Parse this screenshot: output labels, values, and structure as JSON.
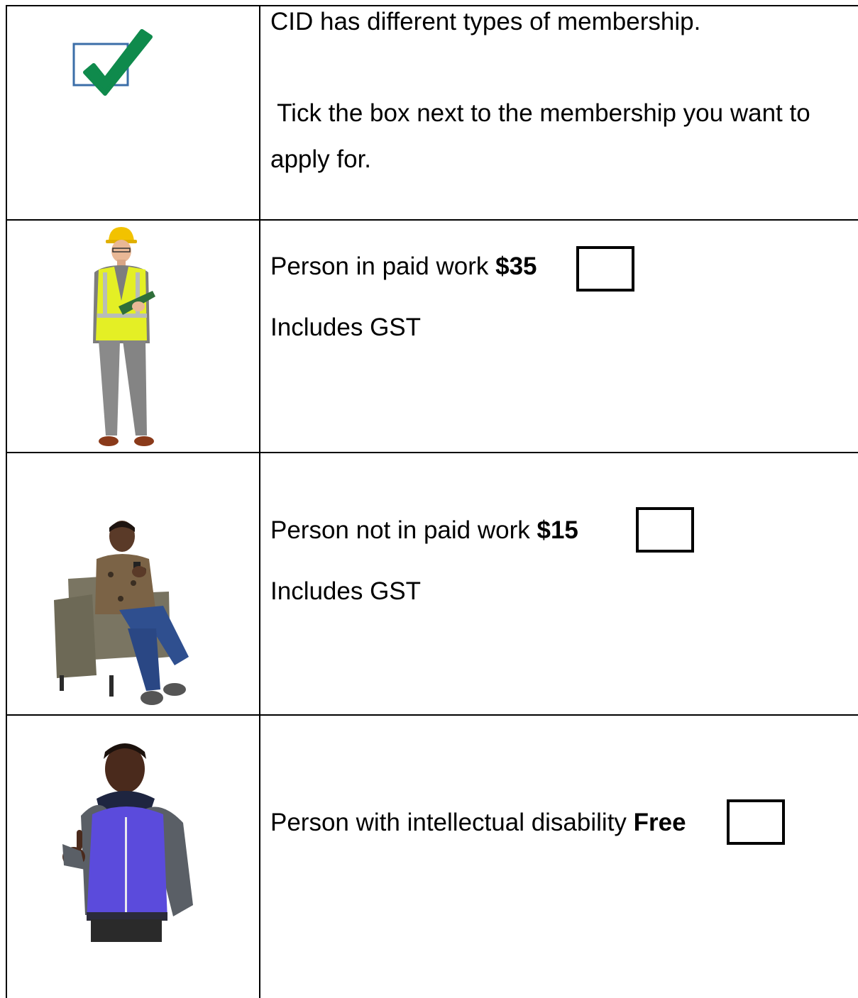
{
  "intro": {
    "line1": "CID has different types of membership.",
    "line2": " Tick the box next to the membership you want to",
    "line3": "apply for.",
    "icon": "checkbox-tick-icon"
  },
  "options": [
    {
      "label": "Person in paid work",
      "price": "$35",
      "note": "Includes GST",
      "checked": false,
      "picture": "worker-in-hi-vis-vest-with-clipboard"
    },
    {
      "label": "Person not in paid work",
      "price": "$15",
      "note": "Includes GST",
      "checked": false,
      "picture": "woman-sitting-in-armchair-with-phone"
    },
    {
      "label": "Person with intellectual disability",
      "price": "Free",
      "checked": false,
      "picture": "man-in-purple-jacket-thumbs-up"
    }
  ],
  "colors": {
    "tick_green": "#0f8a4c",
    "checkbox_blue": "#3b6ea8",
    "hivis_yellow": "#e4ef25",
    "jacket_purple": "#5b4bdc"
  }
}
